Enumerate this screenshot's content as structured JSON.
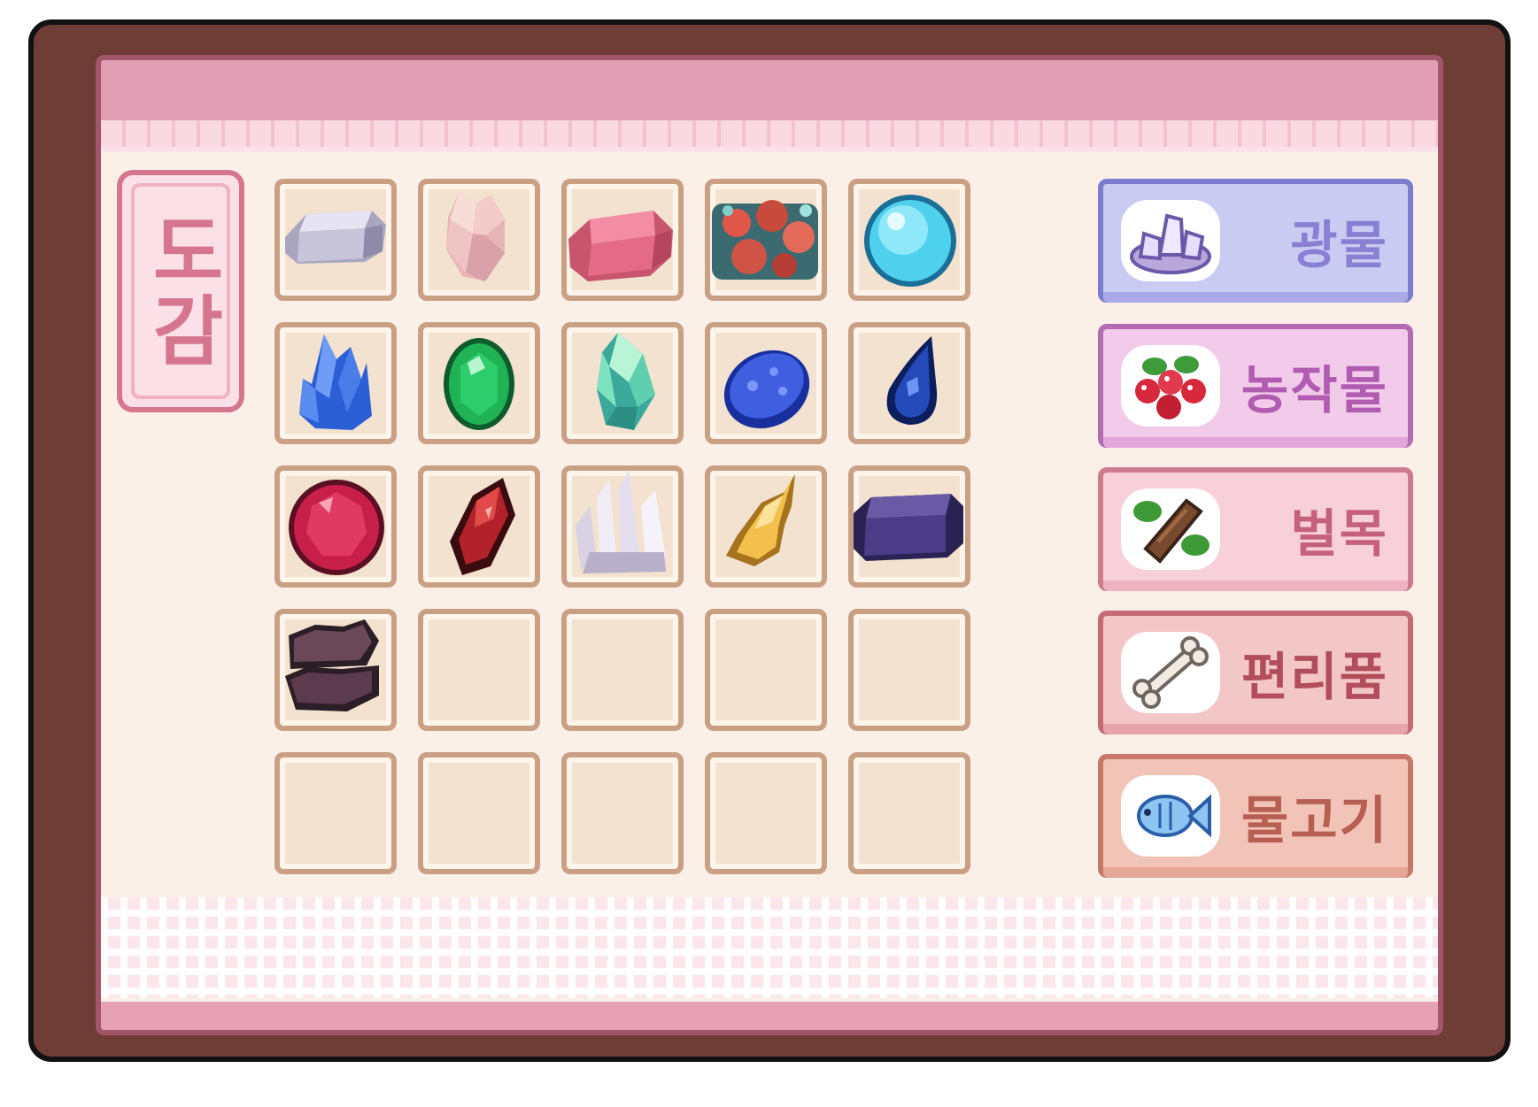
{
  "title": "도감",
  "categories": [
    {
      "label": "광물",
      "icon": "crystal-cluster-icon",
      "bg": "#c9cbf2",
      "border": "#7b7ccd",
      "text": "#8a7fd3",
      "under": "#a8a9e6"
    },
    {
      "label": "농작물",
      "icon": "berries-icon",
      "bg": "#f3cbea",
      "border": "#b46bb4",
      "text": "#b05cb0",
      "under": "#e3a6da"
    },
    {
      "label": "벌목",
      "icon": "wood-log-icon",
      "bg": "#f8d0da",
      "border": "#d07a92",
      "text": "#c4627c",
      "under": "#efb2c1"
    },
    {
      "label": "편리품",
      "icon": "bone-icon",
      "bg": "#f3c6c8",
      "border": "#c66a74",
      "text": "#b24e5b",
      "under": "#e6a4ab"
    },
    {
      "label": "물고기",
      "icon": "fish-icon",
      "bg": "#f2c4b8",
      "border": "#c77767",
      "text": "#b75f52",
      "under": "#e4a696"
    }
  ],
  "items": [
    "silver-ingot-icon",
    "rose-crystal-icon",
    "pink-ingot-icon",
    "copper-ore-icon",
    "aqua-orb-icon",
    "blue-crystal-icon",
    "emerald-icon",
    "mint-crystal-icon",
    "sapphire-ore-icon",
    "blue-teardrop-gem-icon",
    "ruby-icon",
    "garnet-icon",
    "quartz-cluster-icon",
    "gold-nugget-icon",
    "dark-ingot-icon",
    "stacked-slate-icon",
    "",
    "",
    "",
    "",
    "",
    "",
    "",
    "",
    ""
  ]
}
